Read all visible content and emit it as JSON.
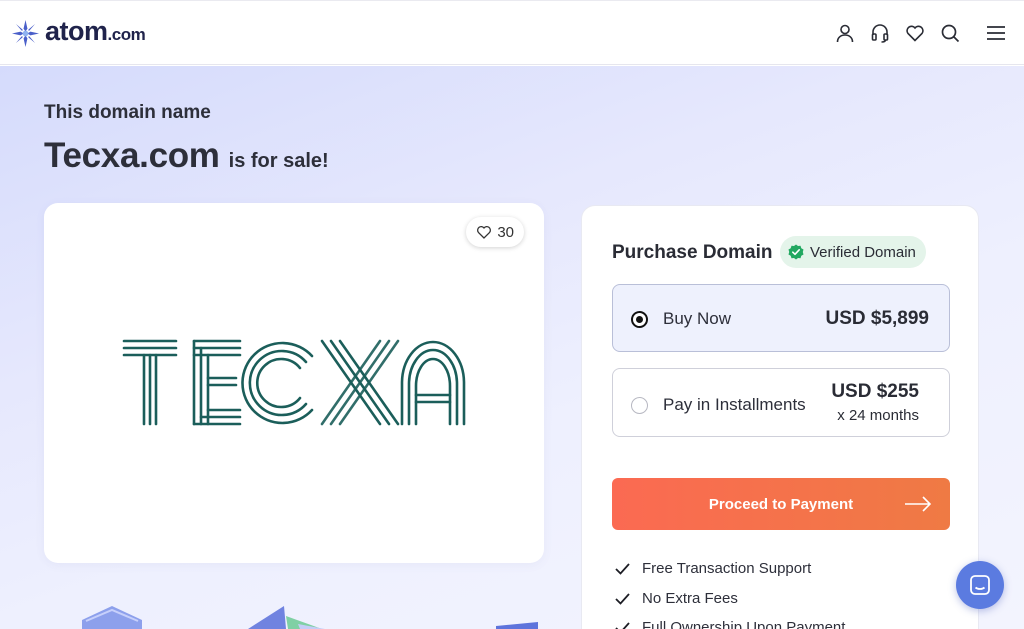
{
  "header": {
    "logo_text": "atom",
    "logo_suffix": ".com",
    "icons": [
      "user-icon",
      "headset-icon",
      "heart-icon",
      "search-icon",
      "menu-icon"
    ]
  },
  "hero": {
    "eyebrow": "This domain name",
    "domain": "Tecxa.com",
    "suffix": "is for sale!"
  },
  "logo_card": {
    "like_count": "30",
    "brand_text": "TECXA",
    "brand_color": "#1b5e5a"
  },
  "purchase": {
    "title": "Purchase Domain",
    "verified_label": "Verified Domain",
    "options": [
      {
        "label": "Buy Now",
        "price": "USD $5,899",
        "sub": "",
        "selected": true
      },
      {
        "label": "Pay in Installments",
        "price": "USD $255",
        "sub": "x 24 months",
        "selected": false
      }
    ],
    "cta_label": "Proceed to Payment",
    "features": [
      "Free Transaction Support",
      "No Extra Fees",
      "Full Ownership Upon Payment"
    ]
  },
  "colors": {
    "accent": "#fb6a52",
    "brand_navy": "#20234b",
    "verified_bg": "#e4f4ea",
    "verified_check": "#22a861",
    "chat_button": "#5b7be0"
  }
}
